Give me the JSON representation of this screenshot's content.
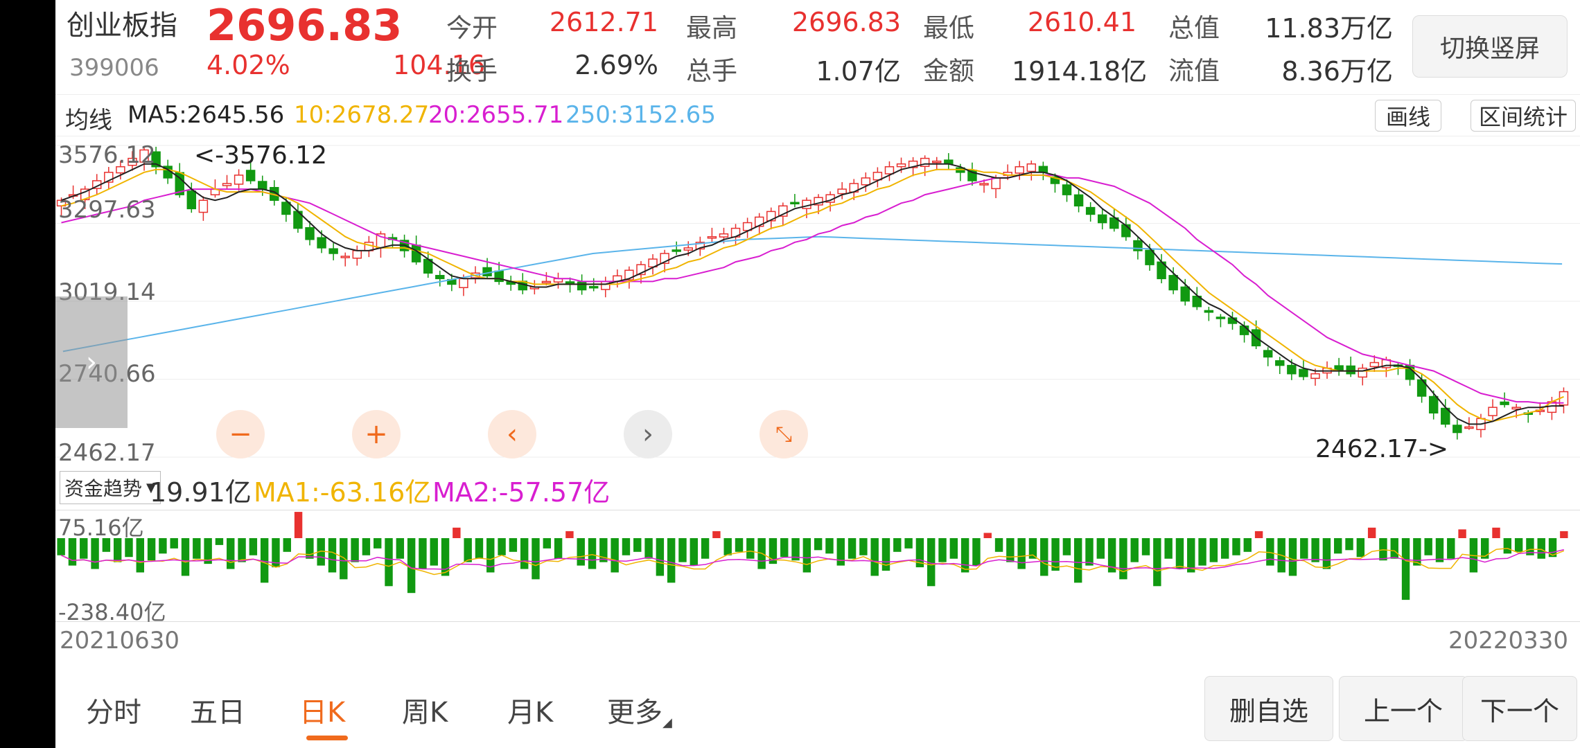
{
  "header": {
    "name": "创业板指",
    "code": "399006",
    "price": "2696.83",
    "change_pct": "4.02%",
    "change": "104.16",
    "stats": [
      {
        "label": "今开",
        "value": "2612.71",
        "color": "#e8312f"
      },
      {
        "label": "最高",
        "value": "2696.83",
        "color": "#e8312f"
      },
      {
        "label": "最低",
        "value": "2610.41",
        "color": "#e8312f"
      },
      {
        "label": "总值",
        "value": "11.83万亿",
        "color": "#333333"
      },
      {
        "label": "换手",
        "value": "2.69%",
        "color": "#333333"
      },
      {
        "label": "总手",
        "value": "1.07亿",
        "color": "#333333"
      },
      {
        "label": "金额",
        "value": "1914.18亿",
        "color": "#333333"
      },
      {
        "label": "流值",
        "value": "8.36万亿",
        "color": "#333333"
      }
    ],
    "switch_label": "切换竖屏"
  },
  "ma_bar": {
    "label": "均线",
    "ma5": "MA5:2645.56",
    "ma10": "10:2678.27",
    "ma20": "20:2655.71",
    "ma250": "250:3152.65",
    "colors": {
      "ma5": "#222222",
      "ma10": "#f0b400",
      "ma20": "#d81ed0",
      "ma250": "#5ab4ea"
    },
    "draw_label": "画线",
    "range_label": "区间统计"
  },
  "chart_data": {
    "type": "candlestick",
    "x_range": [
      "20210630",
      "20220330"
    ],
    "y_labels": [
      "3576.12",
      "3297.63",
      "3019.14",
      "2740.66",
      "2462.17"
    ],
    "ylim": [
      2462.17,
      3576.12
    ],
    "high_marker": "<-3576.12",
    "low_marker": "2462.17->",
    "close_series": [
      3380,
      3400,
      3420,
      3450,
      3480,
      3500,
      3530,
      3560,
      3500,
      3460,
      3400,
      3350,
      3380,
      3420,
      3440,
      3470,
      3450,
      3420,
      3380,
      3330,
      3280,
      3240,
      3210,
      3190,
      3180,
      3200,
      3230,
      3260,
      3240,
      3200,
      3160,
      3120,
      3100,
      3080,
      3100,
      3120,
      3110,
      3090,
      3080,
      3060,
      3070,
      3090,
      3100,
      3080,
      3060,
      3070,
      3090,
      3110,
      3130,
      3150,
      3170,
      3190,
      3200,
      3210,
      3230,
      3250,
      3260,
      3280,
      3300,
      3320,
      3340,
      3360,
      3370,
      3380,
      3390,
      3400,
      3420,
      3440,
      3460,
      3480,
      3500,
      3510,
      3520,
      3530,
      3520,
      3510,
      3480,
      3450,
      3440,
      3460,
      3480,
      3500,
      3510,
      3480,
      3440,
      3400,
      3360,
      3330,
      3300,
      3280,
      3250,
      3200,
      3150,
      3100,
      3060,
      3020,
      3000,
      2980,
      2960,
      2940,
      2900,
      2860,
      2820,
      2790,
      2760,
      2750,
      2760,
      2780,
      2770,
      2760,
      2780,
      2800,
      2810,
      2790,
      2740,
      2680,
      2620,
      2580,
      2550,
      2570,
      2600,
      2640,
      2650,
      2640,
      2620,
      2630,
      2660,
      2696
    ],
    "ma5": [
      3380,
      3395,
      3410,
      3430,
      3450,
      3470,
      3490,
      3510,
      3510,
      3490,
      3460,
      3420,
      3390,
      3380,
      3390,
      3410,
      3420,
      3420,
      3410,
      3380,
      3340,
      3300,
      3260,
      3230,
      3210,
      3200,
      3200,
      3210,
      3220,
      3220,
      3200,
      3170,
      3140,
      3110,
      3100,
      3100,
      3100,
      3100,
      3090,
      3080,
      3070,
      3070,
      3080,
      3080,
      3080,
      3080,
      3080,
      3090,
      3100,
      3120,
      3140,
      3160,
      3180,
      3190,
      3210,
      3220,
      3240,
      3250,
      3270,
      3290,
      3310,
      3330,
      3350,
      3360,
      3370,
      3380,
      3400,
      3410,
      3430,
      3450,
      3470,
      3490,
      3500,
      3510,
      3510,
      3510,
      3500,
      3480,
      3470,
      3460,
      3460,
      3470,
      3480,
      3480,
      3470,
      3450,
      3420,
      3390,
      3350,
      3320,
      3290,
      3250,
      3210,
      3160,
      3120,
      3080,
      3040,
      3010,
      2990,
      2960,
      2930,
      2890,
      2860,
      2830,
      2800,
      2780,
      2770,
      2770,
      2770,
      2770,
      2770,
      2780,
      2790,
      2790,
      2780,
      2740,
      2690,
      2640,
      2600,
      2580,
      2580,
      2590,
      2610,
      2630,
      2640,
      2640,
      2645,
      2645
    ],
    "ma10": [
      3360,
      3370,
      3385,
      3400,
      3420,
      3440,
      3460,
      3480,
      3490,
      3490,
      3480,
      3460,
      3440,
      3420,
      3410,
      3410,
      3410,
      3410,
      3400,
      3390,
      3370,
      3340,
      3310,
      3280,
      3250,
      3230,
      3220,
      3210,
      3210,
      3210,
      3200,
      3190,
      3170,
      3150,
      3130,
      3110,
      3100,
      3100,
      3090,
      3090,
      3080,
      3080,
      3080,
      3080,
      3080,
      3080,
      3080,
      3080,
      3090,
      3100,
      3110,
      3130,
      3140,
      3160,
      3170,
      3190,
      3210,
      3220,
      3240,
      3260,
      3280,
      3290,
      3310,
      3330,
      3340,
      3360,
      3370,
      3390,
      3400,
      3420,
      3430,
      3450,
      3470,
      3480,
      3490,
      3490,
      3490,
      3490,
      3480,
      3480,
      3470,
      3470,
      3470,
      3470,
      3460,
      3450,
      3430,
      3410,
      3380,
      3350,
      3320,
      3290,
      3250,
      3210,
      3170,
      3130,
      3090,
      3050,
      3020,
      2990,
      2960,
      2930,
      2900,
      2870,
      2840,
      2810,
      2790,
      2780,
      2770,
      2770,
      2770,
      2770,
      2770,
      2780,
      2780,
      2760,
      2730,
      2690,
      2650,
      2620,
      2600,
      2590,
      2600,
      2610,
      2620,
      2630,
      2660,
      2678
    ],
    "ma20": [
      3300,
      3310,
      3320,
      3330,
      3340,
      3350,
      3360,
      3380,
      3390,
      3400,
      3410,
      3420,
      3420,
      3420,
      3420,
      3420,
      3420,
      3410,
      3400,
      3390,
      3380,
      3370,
      3350,
      3330,
      3310,
      3290,
      3270,
      3250,
      3240,
      3230,
      3220,
      3210,
      3200,
      3190,
      3180,
      3170,
      3160,
      3150,
      3140,
      3130,
      3120,
      3110,
      3100,
      3100,
      3090,
      3090,
      3090,
      3090,
      3090,
      3090,
      3090,
      3100,
      3100,
      3110,
      3120,
      3130,
      3140,
      3160,
      3170,
      3180,
      3200,
      3210,
      3230,
      3240,
      3260,
      3270,
      3290,
      3300,
      3320,
      3330,
      3350,
      3370,
      3380,
      3400,
      3410,
      3420,
      3430,
      3440,
      3450,
      3460,
      3460,
      3470,
      3470,
      3470,
      3470,
      3460,
      3460,
      3450,
      3440,
      3430,
      3410,
      3390,
      3370,
      3340,
      3310,
      3280,
      3240,
      3210,
      3180,
      3150,
      3110,
      3080,
      3040,
      3010,
      2980,
      2950,
      2920,
      2890,
      2870,
      2850,
      2830,
      2820,
      2810,
      2800,
      2790,
      2780,
      2770,
      2750,
      2730,
      2710,
      2690,
      2680,
      2670,
      2660,
      2660,
      2655,
      2656,
      2656
    ],
    "ma250": [
      2840,
      2850,
      2860,
      2870,
      2880,
      2890,
      2900,
      2910,
      2920,
      2930,
      2940,
      2950,
      2960,
      2970,
      2980,
      2990,
      3000,
      3010,
      3020,
      3030,
      3040,
      3050,
      3060,
      3070,
      3080,
      3090,
      3100,
      3110,
      3120,
      3130,
      3140,
      3150,
      3160,
      3170,
      3180,
      3190,
      3195,
      3200,
      3205,
      3210,
      3215,
      3220,
      3225,
      3230,
      3235,
      3240,
      3242,
      3244,
      3246,
      3248,
      3250,
      3248,
      3246,
      3244,
      3242,
      3240,
      3238,
      3236,
      3234,
      3232,
      3230,
      3228,
      3226,
      3224,
      3222,
      3220,
      3218,
      3216,
      3214,
      3212,
      3210,
      3208,
      3206,
      3204,
      3202,
      3200,
      3198,
      3196,
      3194,
      3192,
      3190,
      3188,
      3186,
      3184,
      3182,
      3180,
      3178,
      3176,
      3174,
      3172,
      3170,
      3168,
      3166,
      3164,
      3162,
      3160,
      3158,
      3156,
      3154,
      3152.65
    ]
  },
  "zoom_icons": [
    "minus-icon",
    "plus-icon",
    "chevron-left-icon",
    "chevron-right-icon",
    "shrink-icon"
  ],
  "flow": {
    "dropdown": "资金趋势",
    "value": "19.91亿",
    "ma1": "MA1:-63.16亿",
    "ma2": "MA2:-57.57亿",
    "top_label": "75.16亿",
    "bottom_label": "-238.40亿",
    "colors": {
      "pos": "#e8312f",
      "neg": "#119911",
      "ma1": "#f0b400",
      "ma2": "#d81ed0"
    },
    "values": [
      -50,
      -80,
      -60,
      -90,
      -40,
      -70,
      -55,
      -100,
      -65,
      -45,
      -30,
      -110,
      -60,
      -75,
      -20,
      -90,
      -70,
      -50,
      -130,
      -85,
      -40,
      75,
      -60,
      -80,
      -100,
      -120,
      -70,
      -50,
      -30,
      -140,
      -60,
      -160,
      -90,
      -80,
      -110,
      30,
      -70,
      -60,
      -100,
      -50,
      -40,
      -90,
      -120,
      -30,
      -60,
      20,
      -80,
      -90,
      -70,
      -100,
      -50,
      -40,
      -60,
      -110,
      -130,
      -70,
      -80,
      -60,
      20,
      -50,
      -40,
      -60,
      -90,
      -75,
      -55,
      -65,
      -100,
      -35,
      -45,
      -80,
      -60,
      -50,
      -110,
      -95,
      -40,
      -30,
      -85,
      -140,
      -70,
      -60,
      -100,
      -80,
      15,
      -40,
      -70,
      -90,
      -60,
      -110,
      -95,
      -50,
      -130,
      -80,
      -60,
      -100,
      -120,
      -70,
      -50,
      -140,
      -60,
      -90,
      -100,
      -80,
      -70,
      -60,
      -50,
      -40,
      20,
      -80,
      -100,
      -110,
      -60,
      -70,
      -90,
      -45,
      -35,
      -55,
      30,
      -65,
      -60,
      -180,
      -80,
      -50,
      -70,
      -60,
      25,
      -100,
      -60,
      30,
      -45,
      -40,
      -50,
      -60,
      -55,
      20
    ]
  },
  "dates": {
    "start": "20210630",
    "end": "20220330"
  },
  "tabs": [
    {
      "label": "分时"
    },
    {
      "label": "五日"
    },
    {
      "label": "日K"
    },
    {
      "label": "周K"
    },
    {
      "label": "月K"
    },
    {
      "label": "更多"
    }
  ],
  "actions": {
    "del": "删自选",
    "prev": "上一个",
    "next": "下一个"
  }
}
